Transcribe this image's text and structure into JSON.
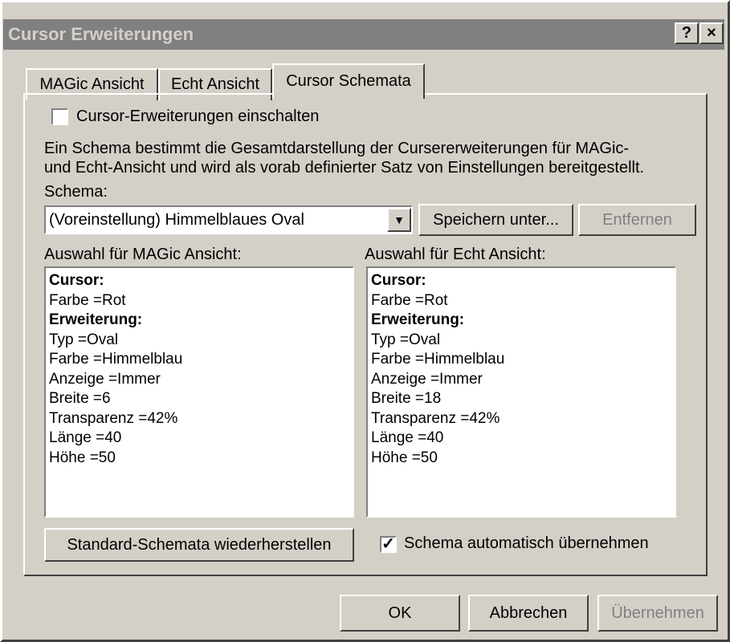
{
  "window": {
    "title": "Cursor Erweiterungen",
    "help_label": "?",
    "close_label": "×"
  },
  "tabs": [
    {
      "label": "MAGic Ansicht",
      "selected": false
    },
    {
      "label": "Echt Ansicht",
      "selected": false
    },
    {
      "label": "Cursor Schemata",
      "selected": true
    }
  ],
  "enable_checkbox": {
    "label": "Cursor-Erweiterungen einschalten",
    "checked": false
  },
  "description": {
    "line1": "Ein Schema bestimmt die Gesamtdarstellung der Cursererweiterungen für MAGic-",
    "line2": "und Echt-Ansicht und wird als vorab definierter Satz von Einstellungen bereitgestellt."
  },
  "schema": {
    "label": "Schema:",
    "selected": "(Voreinstellung) Himmelblaues Oval",
    "arrow": "▼"
  },
  "buttons": {
    "save_as": "Speichern unter...",
    "remove": "Entfernen",
    "restore": "Standard-Schemata wiederherstellen",
    "ok": "OK",
    "cancel": "Abbrechen",
    "apply": "Übernehmen"
  },
  "magic_list": {
    "label": "Auswahl für MAGic Ansicht:",
    "lines": [
      "Cursor:",
      "Farbe =Rot",
      "Erweiterung:",
      "Typ =Oval",
      "Farbe =Himmelblau",
      "Anzeige =Immer",
      "Breite =6",
      "Transparenz =42%",
      "Länge =40",
      "Höhe =50"
    ]
  },
  "echt_list": {
    "label": "Auswahl für Echt Ansicht:",
    "lines": [
      "Cursor:",
      "Farbe =Rot",
      "Erweiterung:",
      "Typ =Oval",
      "Farbe =Himmelblau",
      "Anzeige =Immer",
      "Breite =18",
      "Transparenz =42%",
      "Länge =40",
      "Höhe =50"
    ]
  },
  "auto_apply_checkbox": {
    "label": "Schema automatisch übernehmen",
    "checked": true,
    "mark": "✓"
  },
  "colors": {
    "titlebar": "#808080",
    "face": "#d4d0c8",
    "disabled_text": "#808080"
  }
}
